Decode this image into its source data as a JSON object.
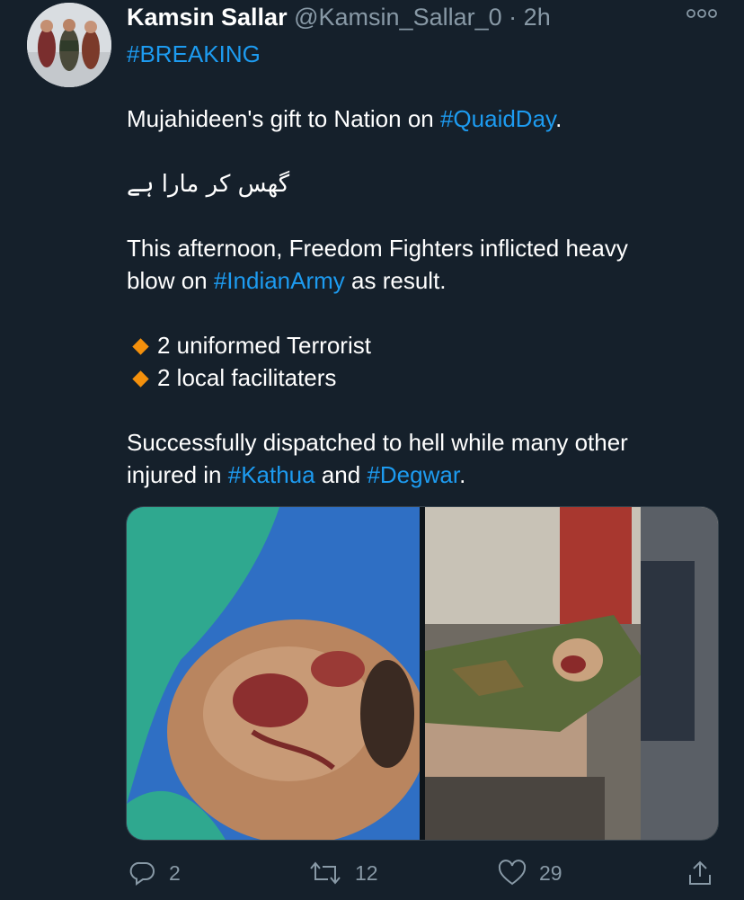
{
  "author": {
    "name": "Kamsin Sallar",
    "handle": "@Kamsin_Sallar_0",
    "separator": "·",
    "time": "2h"
  },
  "body": {
    "hashtag_breaking": "#BREAKING",
    "line1_pre": "Mujahideen's gift to Nation on ",
    "line1_tag": "#QuaidDay",
    "line1_post": ".",
    "urdu": "گھس کر مارا ہے",
    "line3": "This afternoon, Freedom Fighters inflicted heavy",
    "line4_pre": "blow on ",
    "line4_tag": "#IndianArmy",
    "line4_post": " as result.",
    "bullets": [
      "2 uniformed Terrorist",
      "2 local facilitaters"
    ],
    "line7": "Successfully dispatched to hell while many other",
    "line8_pre": "injured in ",
    "line8_tag1": "#Kathua",
    "line8_mid": " and ",
    "line8_tag2": "#Degwar",
    "line8_post": "."
  },
  "actions": {
    "replies": "2",
    "retweets": "12",
    "likes": "29"
  },
  "colors": {
    "background": "#15202b",
    "link": "#1d9bf0",
    "muted": "#8899a6",
    "bullet": "#f4900c"
  },
  "icons": [
    "more-options-icon",
    "reply-icon",
    "retweet-icon",
    "like-icon",
    "share-icon"
  ]
}
